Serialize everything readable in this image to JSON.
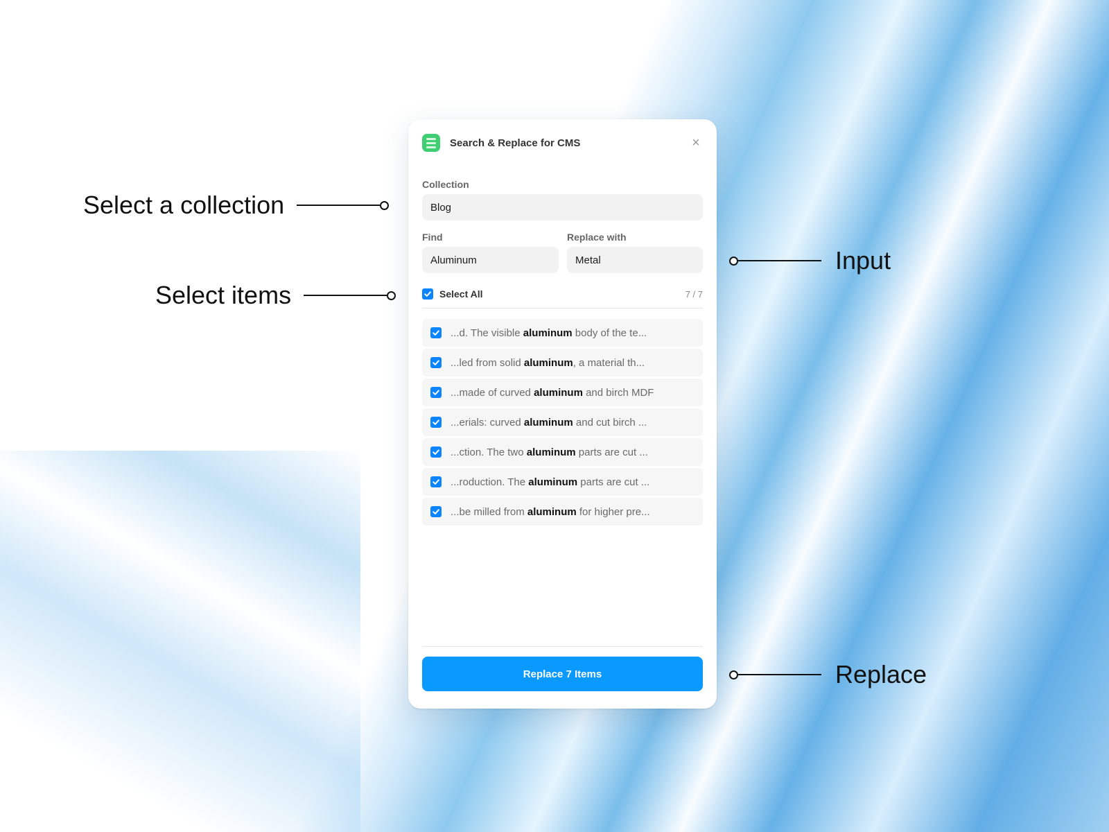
{
  "callouts": {
    "collection": "Select a collection",
    "items": "Select items",
    "input": "Input",
    "replace": "Replace"
  },
  "panel": {
    "title": "Search & Replace for CMS",
    "close_label": "×",
    "collection": {
      "label": "Collection",
      "value": "Blog"
    },
    "find": {
      "label": "Find",
      "value": "Aluminum"
    },
    "replace_with": {
      "label": "Replace with",
      "value": "Metal"
    },
    "select_all": {
      "label": "Select All",
      "checked": true,
      "count": "7 / 7"
    },
    "results": [
      {
        "before": "...d. The visible ",
        "match": "aluminum",
        "after": " body of the te...",
        "checked": true
      },
      {
        "before": "...led from solid ",
        "match": "aluminum",
        "after": ", a material th...",
        "checked": true
      },
      {
        "before": "...made of curved ",
        "match": "aluminum",
        "after": " and birch MDF",
        "checked": true
      },
      {
        "before": "...erials: curved ",
        "match": "aluminum",
        "after": " and cut birch ...",
        "checked": true
      },
      {
        "before": "...ction. The two ",
        "match": "aluminum",
        "after": " parts are cut ...",
        "checked": true
      },
      {
        "before": "...roduction. The ",
        "match": "aluminum",
        "after": " parts are cut ...",
        "checked": true
      },
      {
        "before": "...be milled from ",
        "match": "aluminum",
        "after": " for higher pre...",
        "checked": true
      }
    ],
    "replace_button": "Replace 7 Items"
  },
  "colors": {
    "accent": "#0a99ff",
    "checkbox": "#0a84ff",
    "app_icon": "#3fcf72"
  },
  "icons": {
    "app": "list-icon",
    "close": "close-icon",
    "checkbox": "check-icon"
  }
}
